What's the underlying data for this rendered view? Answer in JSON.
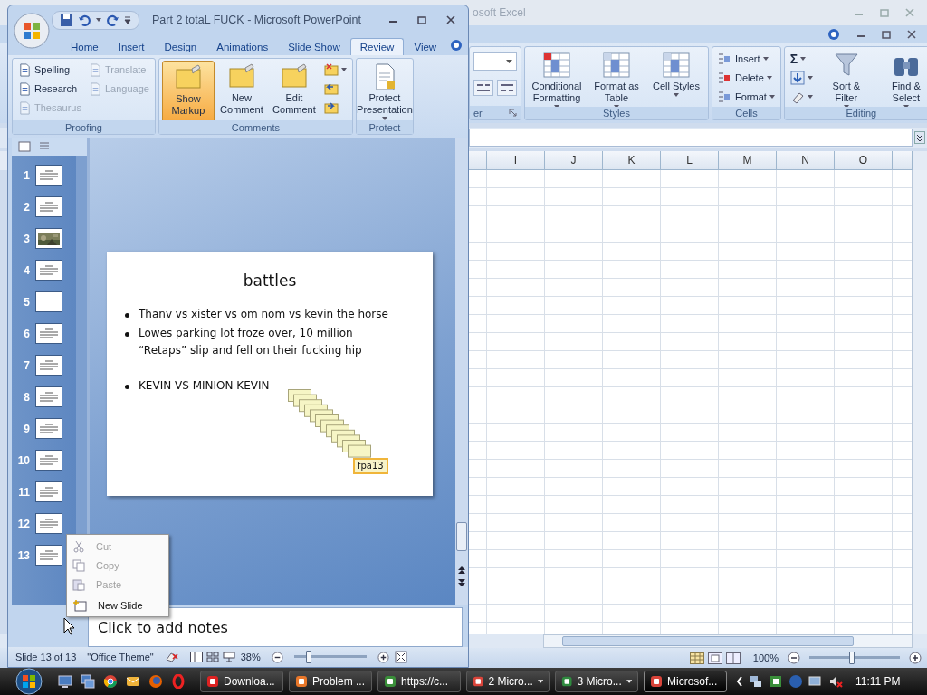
{
  "excel": {
    "title": "osoft Excel",
    "number_group_label": "er",
    "groups": [
      {
        "label": "Styles",
        "buttons": [
          {
            "label": "Conditional Formatting",
            "kind": "large",
            "dropdown": true
          },
          {
            "label": "Format as Table",
            "kind": "large",
            "dropdown": true
          },
          {
            "label": "Cell Styles",
            "kind": "large",
            "dropdown": true
          }
        ]
      },
      {
        "label": "Cells",
        "buttons": [
          {
            "label": "Insert",
            "kind": "small",
            "dropdown": true
          },
          {
            "label": "Delete",
            "kind": "small",
            "dropdown": true
          },
          {
            "label": "Format",
            "kind": "small",
            "dropdown": true
          }
        ]
      },
      {
        "label": "Editing",
        "buttons": [
          {
            "label": "Σ",
            "kind": "small",
            "dropdown": true
          },
          {
            "kind": "icon",
            "dropdown": true
          },
          {
            "kind": "icon",
            "dropdown": true
          },
          {
            "label": "Sort & Filter",
            "kind": "large",
            "dropdown": true
          },
          {
            "label": "Find & Select",
            "kind": "large",
            "dropdown": true
          }
        ]
      }
    ],
    "columns": [
      "I",
      "J",
      "K",
      "L",
      "M",
      "N",
      "O"
    ],
    "zoom": "100%",
    "zoom_slider": {
      "level": 0.47
    }
  },
  "powerpoint": {
    "title": "Part 2 totaL FUCK - Microsoft PowerPoint",
    "tabs": [
      {
        "label": "Home",
        "selected": false
      },
      {
        "label": "Insert",
        "selected": false
      },
      {
        "label": "Design",
        "selected": false
      },
      {
        "label": "Animations",
        "selected": false
      },
      {
        "label": "Slide Show",
        "selected": false
      },
      {
        "label": "Review",
        "selected": true
      },
      {
        "label": "View",
        "selected": false
      }
    ],
    "groups": [
      {
        "label": "Proofing",
        "buttons": [
          {
            "label": "Spelling",
            "kind": "small",
            "disabled": false
          },
          {
            "label": "Research",
            "kind": "small",
            "disabled": false
          },
          {
            "label": "Thesaurus",
            "kind": "small",
            "disabled": true
          },
          {
            "label": "Translate",
            "kind": "small",
            "disabled": true
          },
          {
            "label": "Language",
            "kind": "small",
            "disabled": true
          }
        ]
      },
      {
        "label": "Comments",
        "buttons": [
          {
            "label": "Show Markup",
            "kind": "large",
            "selected": true
          },
          {
            "label": "New Comment",
            "kind": "large",
            "selected": false
          },
          {
            "label": "Edit Comment",
            "kind": "large",
            "selected": false
          },
          {
            "kind": "icon",
            "dropdown": true
          },
          {
            "kind": "icon"
          },
          {
            "kind": "icon"
          }
        ]
      },
      {
        "label": "Protect",
        "buttons": [
          {
            "label": "Protect Presentation",
            "kind": "large",
            "dropdown": true
          }
        ]
      }
    ],
    "thumbnails": [
      {
        "number": "1",
        "kind": "text"
      },
      {
        "number": "2",
        "kind": "text"
      },
      {
        "number": "3",
        "kind": "picture"
      },
      {
        "number": "4",
        "kind": "text"
      },
      {
        "number": "5",
        "kind": "blank"
      },
      {
        "number": "6",
        "kind": "text"
      },
      {
        "number": "7",
        "kind": "text"
      },
      {
        "number": "8",
        "kind": "text"
      },
      {
        "number": "9",
        "kind": "text"
      },
      {
        "number": "10",
        "kind": "text"
      },
      {
        "number": "11",
        "kind": "text"
      },
      {
        "number": "12",
        "kind": "text"
      },
      {
        "number": "13",
        "kind": "text"
      }
    ],
    "slide": {
      "title": "battles",
      "bullets": [
        {
          "text": "Thanv vs xister vs om nom vs kevin the horse"
        },
        {
          "text": "Lowes parking lot froze over, 10 million “Retaps” slip and fell on their fucking hip"
        },
        {
          "text": "KEVIN VS MINION KEVIN",
          "gap": true
        }
      ],
      "comment": {
        "label": "fpa13"
      }
    },
    "context_menu": [
      {
        "label": "Cut",
        "disabled": true
      },
      {
        "label": "Copy",
        "disabled": true
      },
      {
        "label": "Paste",
        "disabled": true
      },
      {
        "label": "New Slide",
        "disabled": false
      }
    ],
    "notes": {
      "placeholder": "Click to add notes"
    },
    "status_bar": {
      "slide": "Slide 13 of 13",
      "theme": "\"Office Theme\"",
      "zoom": "38%",
      "zoom_slider": {
        "level": 0.2
      }
    }
  },
  "taskbar": {
    "buttons": [
      {
        "label": "Downloa...",
        "selected": false,
        "dropdown": false
      },
      {
        "label": "Problem ...",
        "selected": false,
        "dropdown": false
      },
      {
        "label": "https://c...",
        "selected": false,
        "dropdown": false
      },
      {
        "label": "2 Micro...",
        "selected": false,
        "dropdown": true
      },
      {
        "label": "3 Micro...",
        "selected": false,
        "dropdown": true
      },
      {
        "label": "Microsof...",
        "selected": true,
        "dropdown": false
      }
    ],
    "clock": "11:11 PM"
  }
}
